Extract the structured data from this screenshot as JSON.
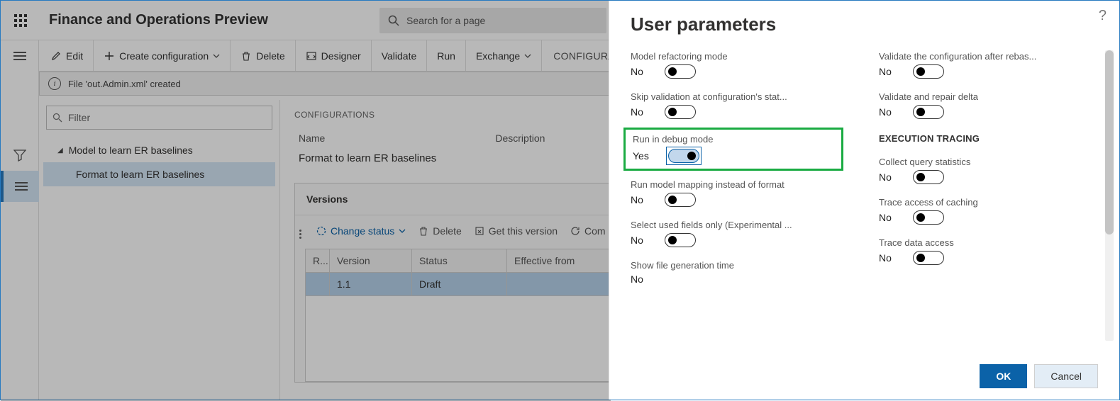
{
  "header": {
    "app_title": "Finance and Operations Preview",
    "search_placeholder": "Search for a page"
  },
  "actionbar": {
    "edit": "Edit",
    "create": "Create configuration",
    "delete": "Delete",
    "designer": "Designer",
    "validate": "Validate",
    "run": "Run",
    "exchange": "Exchange",
    "crumb": "CONFIGURAT"
  },
  "infobar": {
    "message": "File 'out.Admin.xml' created"
  },
  "sidebar": {
    "filter_placeholder": "Filter",
    "tree": [
      {
        "label": "Model to learn ER baselines",
        "expanded": true
      },
      {
        "label": "Format to learn ER baselines",
        "child": true,
        "selected": true
      }
    ]
  },
  "main": {
    "section_label": "CONFIGURATIONS",
    "name_header": "Name",
    "description_header": "Description",
    "name_value": "Format to learn ER baselines",
    "versions_title": "Versions",
    "version_toolbar": {
      "change_status": "Change status",
      "delete": "Delete",
      "get_version": "Get this version",
      "compare": "Com"
    },
    "version_headers": {
      "r": "R...",
      "version": "Version",
      "status": "Status",
      "effective": "Effective from"
    },
    "version_rows": [
      {
        "version": "1.1",
        "status": "Draft",
        "effective": ""
      }
    ]
  },
  "panel": {
    "title": "User parameters",
    "subhead_tracing": "EXECUTION TRACING",
    "yes": "Yes",
    "no": "No",
    "params_left": [
      {
        "label": "Model refactoring mode",
        "on": false
      },
      {
        "label": "Skip validation at configuration's stat...",
        "on": false
      },
      {
        "label": "Run in debug mode",
        "on": true,
        "highlight": true
      },
      {
        "label": "Run model mapping instead of format",
        "on": false
      },
      {
        "label": "Select used fields only (Experimental ...",
        "on": false
      },
      {
        "label": "Show file generation time",
        "on": false,
        "notoggle": true
      }
    ],
    "params_right": [
      {
        "label": "Validate the configuration after rebas...",
        "on": false
      },
      {
        "label": "Validate and repair delta",
        "on": false
      },
      {
        "label": "Collect query statistics",
        "on": false,
        "head_before": true
      },
      {
        "label": "Trace access of caching",
        "on": false
      },
      {
        "label": "Trace data access",
        "on": false
      }
    ],
    "ok": "OK",
    "cancel": "Cancel"
  }
}
